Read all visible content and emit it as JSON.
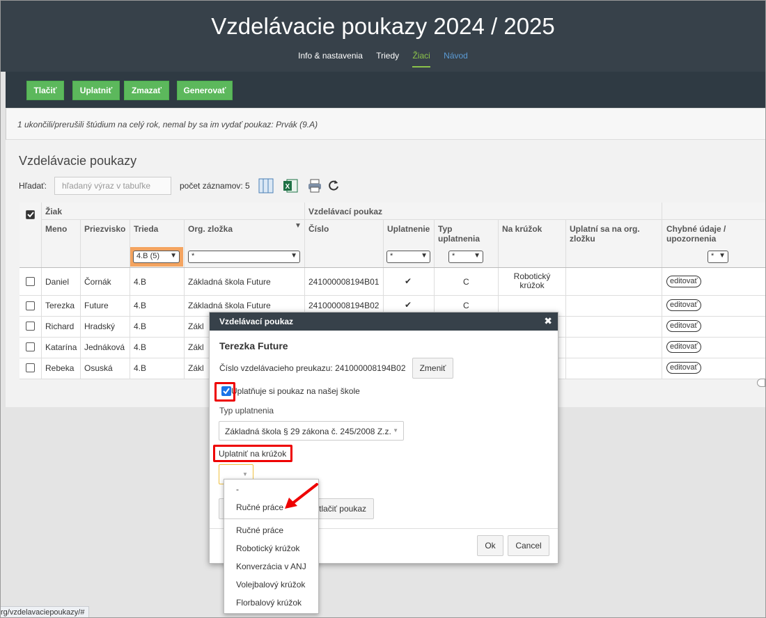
{
  "header": {
    "title": "Vzdelávacie poukazy 2024 / 2025",
    "nav": [
      "Info & nastavenia",
      "Triedy",
      "Žiaci",
      "Návod"
    ]
  },
  "toolbar": {
    "buttons": [
      "Tlačiť",
      "Uplatniť",
      "Zmazať",
      "Generovať"
    ]
  },
  "notice": "1 ukončili/prerušili štúdium na celý rok, nemal by sa im vydať poukaz: Prvák (9.A)",
  "section": {
    "title": "Vzdelávacie poukazy",
    "search_label": "Hľadať:",
    "search_placeholder": "hľadaný výraz v tabuľke",
    "count_label": "počet záznamov: 5"
  },
  "table": {
    "groups": [
      "Žiak",
      "Vzdelávací poukaz"
    ],
    "headers": {
      "meno": "Meno",
      "priezvisko": "Priezvisko",
      "trieda": "Trieda",
      "org": "Org. zložka",
      "cislo": "Číslo",
      "uplatnenie": "Uplatnenie",
      "typ": "Typ uplatnenia",
      "kruzok": "Na krúžok",
      "uplatni_org": "Uplatní sa na org. zložku",
      "chybne": "Chybné údaje / upozornenia"
    },
    "filters": {
      "trieda": "4.B (5)",
      "org": "*",
      "uplatnenie": "*",
      "typ": "*",
      "chybne": "*"
    },
    "rows": [
      {
        "meno": "Daniel",
        "priezvisko": "Čornák",
        "trieda": "4.B",
        "org": "Základná škola Future",
        "cislo": "241000008194B01",
        "uplatnenie": "✔",
        "typ": "C",
        "kruzok": "Robotický krúžok",
        "action": "editovať"
      },
      {
        "meno": "Terezka",
        "priezvisko": "Future",
        "trieda": "4.B",
        "org": "Základná škola Future",
        "cislo": "241000008194B02",
        "uplatnenie": "✔",
        "typ": "C",
        "kruzok": "",
        "action": "editovať"
      },
      {
        "meno": "Richard",
        "priezvisko": "Hradský",
        "trieda": "4.B",
        "org": "Zákl",
        "cislo": "",
        "uplatnenie": "",
        "typ": "",
        "kruzok": "",
        "action": "editovať"
      },
      {
        "meno": "Katarína",
        "priezvisko": "Jednáková",
        "trieda": "4.B",
        "org": "Zákl",
        "cislo": "",
        "uplatnenie": "",
        "typ": "",
        "kruzok": "",
        "action": "editovať"
      },
      {
        "meno": "Rebeka",
        "priezvisko": "Osuská",
        "trieda": "4.B",
        "org": "Zákl",
        "cislo": "",
        "uplatnenie": "",
        "typ": "",
        "kruzok": "",
        "action": "editovať"
      }
    ]
  },
  "modal": {
    "title": "Vzdelávací poukaz",
    "student": "Terezka Future",
    "card_number": "Číslo vzdelávacieho preukazu: 241000008194B02",
    "change_btn": "Zmeniť",
    "checkbox_label": "Uplatňuje si poukaz na našej škole",
    "typ_label": "Typ uplatnenia",
    "typ_value": "Základná škola § 29 zákona č. 245/2008 Z.z.",
    "kruzok_label": "Uplatniť na krúžok",
    "print_btn": "Vytlačiť poukaz",
    "ok": "Ok",
    "cancel": "Cancel"
  },
  "dropdown": {
    "options": [
      "-",
      "Ručné práce",
      "Ručné práce",
      "Robotický krúžok",
      "Konverzácia v ANJ",
      "Volejbalový krúžok",
      "Florbalový krúžok"
    ]
  },
  "statusbar": "rg/vzdelavaciepoukazy/#",
  "colors": {
    "header": "#37414a",
    "green": "#5cb85c",
    "active": "#8bc34a",
    "highlight": "#e00000",
    "filter": "#f4a460"
  }
}
